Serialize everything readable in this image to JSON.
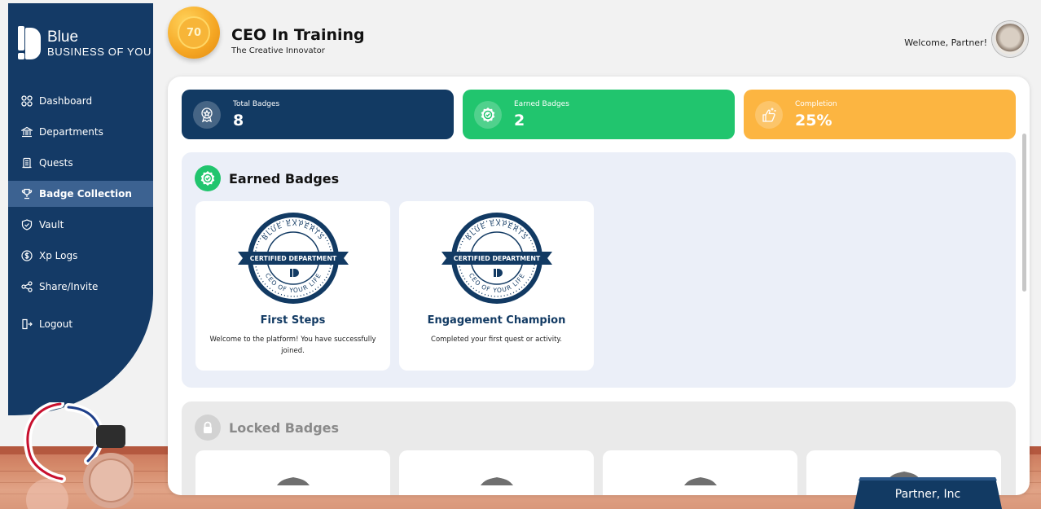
{
  "brand": {
    "name": "Blue",
    "tagline": "BUSINESS OF YOU"
  },
  "nav": {
    "items": [
      {
        "id": "dashboard",
        "label": "Dashboard",
        "icon": "grid-icon"
      },
      {
        "id": "departments",
        "label": "Departments",
        "icon": "building-icon"
      },
      {
        "id": "quests",
        "label": "Quests",
        "icon": "scroll-icon"
      },
      {
        "id": "badge-collection",
        "label": "Badge Collection",
        "icon": "trophy-icon",
        "active": true
      },
      {
        "id": "vault",
        "label": "Vault",
        "icon": "shield-icon"
      },
      {
        "id": "xp-logs",
        "label": "Xp Logs",
        "icon": "dollar-circle-icon"
      },
      {
        "id": "share-invite",
        "label": "Share/Invite",
        "icon": "share-icon"
      }
    ],
    "logout": "Logout"
  },
  "header": {
    "level": "70",
    "rank_title": "CEO In Training",
    "rank_subtitle": "The Creative Innovator",
    "welcome": "Welcome, Partner!"
  },
  "stats": {
    "total": {
      "label": "Total Badges",
      "value": "8"
    },
    "earned": {
      "label": "Earned Badges",
      "value": "2"
    },
    "completion": {
      "label": "Completion",
      "value": "25%"
    }
  },
  "earned_section": {
    "title": "Earned Badges",
    "badges": [
      {
        "name": "First Steps",
        "description": "Welcome to the platform! You have successfully joined."
      },
      {
        "name": "Engagement Champion",
        "description": "Completed your first quest or activity."
      }
    ]
  },
  "badge_art": {
    "top_text": "BLUE EXPERTS",
    "ribbon_text": "CERTIFIED DEPARTMENT",
    "bottom_text": "CEO OF YOUR LIFE"
  },
  "locked_section": {
    "title": "Locked Badges"
  },
  "nameplate": {
    "text": "Partner, Inc"
  },
  "colors": {
    "sidebar": "#143a66",
    "sidebar_active": "#3c6291",
    "navy": "#123a63",
    "green": "#21c56e",
    "orange": "#fcb541",
    "coin": "#f5a623"
  }
}
